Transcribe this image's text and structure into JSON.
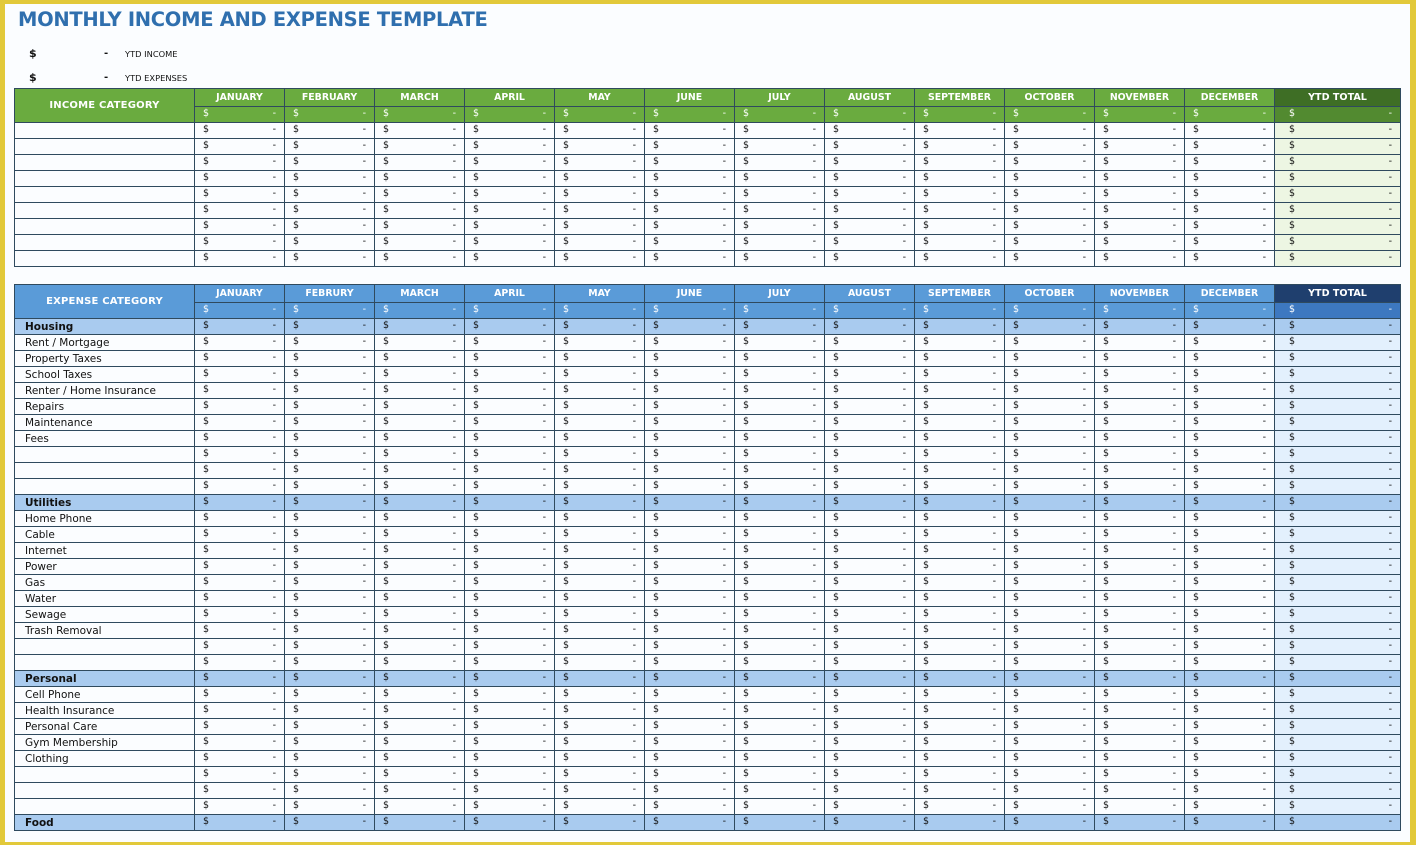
{
  "title": "MONTHLY INCOME AND EXPENSE TEMPLATE",
  "summary": [
    {
      "currency": "$",
      "value": "-",
      "label": "YTD INCOME"
    },
    {
      "currency": "$",
      "value": "-",
      "label": "YTD EXPENSES"
    }
  ],
  "currency_symbol": "$",
  "empty_value": "-",
  "colors": {
    "income_header": "#6aab3f",
    "income_ytd_header": "#3e6e25",
    "expense_header": "#5a9bd8",
    "expense_ytd_header": "#1f3f6e",
    "expense_group_row": "#a9cbef",
    "frame": "#e2c93a",
    "title": "#2f6fae"
  },
  "income": {
    "category_header": "INCOME CATEGORY",
    "months": [
      "JANUARY",
      "FEBRUARY",
      "MARCH",
      "APRIL",
      "MAY",
      "JUNE",
      "JULY",
      "AUGUST",
      "SEPTEMBER",
      "OCTOBER",
      "NOVEMBER",
      "DECEMBER"
    ],
    "ytd_header": "YTD TOTAL",
    "rows": [
      {
        "label": "",
        "group": false
      },
      {
        "label": "",
        "group": false
      },
      {
        "label": "",
        "group": false
      },
      {
        "label": "",
        "group": false
      },
      {
        "label": "",
        "group": false
      },
      {
        "label": "",
        "group": false
      },
      {
        "label": "",
        "group": false
      },
      {
        "label": "",
        "group": false
      },
      {
        "label": "",
        "group": false
      }
    ]
  },
  "expense": {
    "category_header": "EXPENSE CATEGORY",
    "months": [
      "JANUARY",
      "FEBRURY",
      "MARCH",
      "APRIL",
      "MAY",
      "JUNE",
      "JULY",
      "AUGUST",
      "SEPTEMBER",
      "OCTOBER",
      "NOVEMBER",
      "DECEMBER"
    ],
    "ytd_header": "YTD TOTAL",
    "rows": [
      {
        "label": "Housing",
        "group": true
      },
      {
        "label": "Rent / Mortgage",
        "group": false
      },
      {
        "label": "Property Taxes",
        "group": false
      },
      {
        "label": "School Taxes",
        "group": false
      },
      {
        "label": "Renter / Home Insurance",
        "group": false
      },
      {
        "label": "Repairs",
        "group": false
      },
      {
        "label": "Maintenance",
        "group": false
      },
      {
        "label": "Fees",
        "group": false
      },
      {
        "label": "",
        "group": false
      },
      {
        "label": "",
        "group": false
      },
      {
        "label": "",
        "group": false
      },
      {
        "label": "Utilities",
        "group": true
      },
      {
        "label": "Home Phone",
        "group": false
      },
      {
        "label": "Cable",
        "group": false
      },
      {
        "label": "Internet",
        "group": false
      },
      {
        "label": "Power",
        "group": false
      },
      {
        "label": "Gas",
        "group": false
      },
      {
        "label": "Water",
        "group": false
      },
      {
        "label": "Sewage",
        "group": false
      },
      {
        "label": "Trash Removal",
        "group": false
      },
      {
        "label": "",
        "group": false
      },
      {
        "label": "",
        "group": false
      },
      {
        "label": "Personal",
        "group": true
      },
      {
        "label": "Cell Phone",
        "group": false
      },
      {
        "label": "Health Insurance",
        "group": false
      },
      {
        "label": "Personal Care",
        "group": false
      },
      {
        "label": "Gym Membership",
        "group": false
      },
      {
        "label": "Clothing",
        "group": false
      },
      {
        "label": "",
        "group": false
      },
      {
        "label": "",
        "group": false
      },
      {
        "label": "",
        "group": false
      },
      {
        "label": "Food",
        "group": true
      }
    ]
  }
}
